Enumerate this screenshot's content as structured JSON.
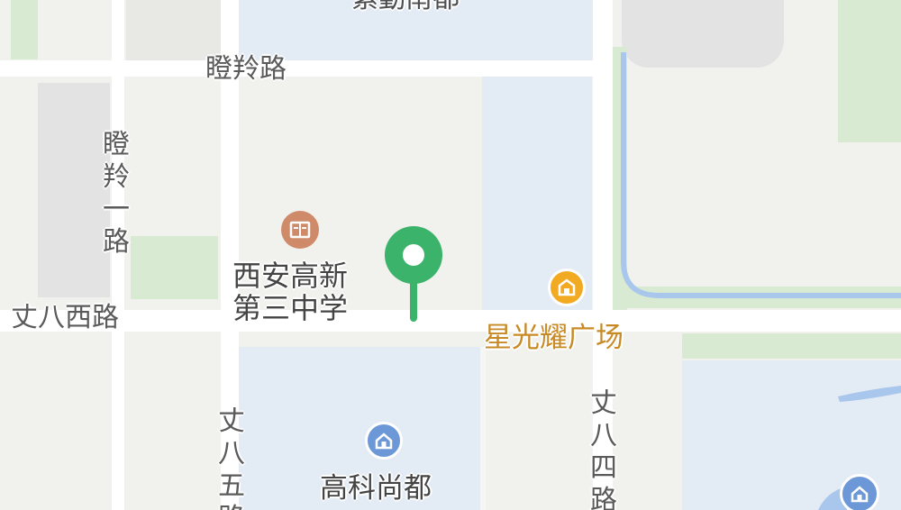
{
  "roads": {
    "top": "瞪羚路",
    "left_vertical": "瞪羚一路",
    "middle": "丈八西路",
    "bottom_left_vertical": "丈八五路",
    "right_vertical": "丈八四路"
  },
  "pois": {
    "top_cutoff": "紫勤南都",
    "school": "西安高新第三中学",
    "plaza": "星光耀广场",
    "residential": "高科尚都"
  },
  "icons": {
    "school": "school-icon",
    "plaza": "shopping-icon",
    "residential": "home-icon",
    "residential_right": "home-icon",
    "marker": "location-pin-icon"
  },
  "colors": {
    "land": "#f1f1ee",
    "road": "#ffffff",
    "residential_area": "#e3ebf5",
    "green_area": "#d8ebd2",
    "building": "#e3e3e3",
    "water": "#a9c6ec",
    "marker": "#3bb36a",
    "school_icon": "#cf8a6a",
    "plaza_icon": "#f2aa22",
    "plaza_text": "#c88a25",
    "home_icon": "#6d98d8",
    "school_text": "#444444"
  }
}
